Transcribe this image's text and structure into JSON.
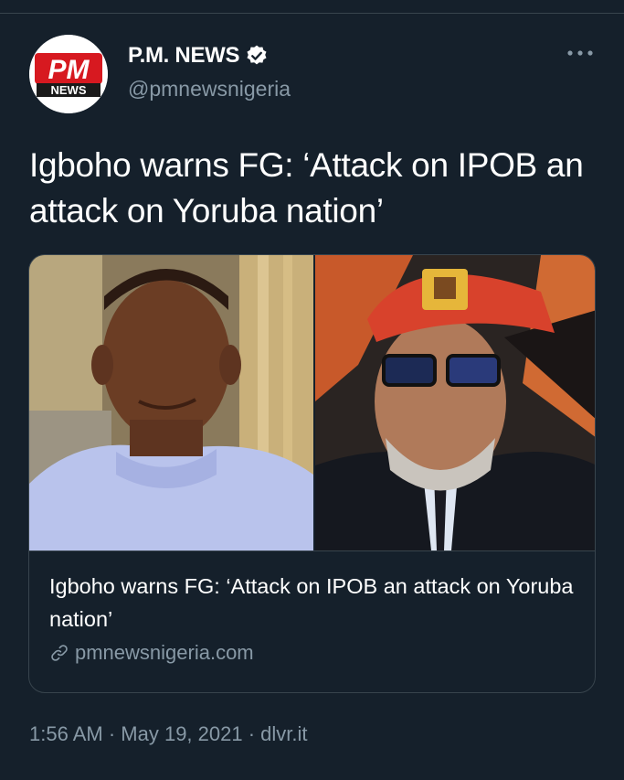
{
  "author": {
    "display_name": "P.M. NEWS",
    "handle": "@pmnewsnigeria",
    "avatar_text_top": "PM",
    "avatar_text_bottom": "NEWS"
  },
  "tweet": {
    "text": "Igboho warns FG: ‘Attack on IPOB an attack on Yoruba nation’"
  },
  "card": {
    "title": "Igboho warns FG: ‘Attack on IPOB an attack on Yoruba nation’",
    "domain": "pmnewsnigeria.com"
  },
  "meta": {
    "time": "1:56 AM",
    "separator": " · ",
    "date": "May 19, 2021",
    "source": "dlvr.it"
  },
  "icons": {
    "verified": "verified-badge-icon",
    "more": "more-options-icon",
    "link": "link-icon"
  },
  "colors": {
    "background": "#15202b",
    "secondary_text": "#8899a6",
    "border": "#38444d",
    "brand_red": "#d71920"
  }
}
